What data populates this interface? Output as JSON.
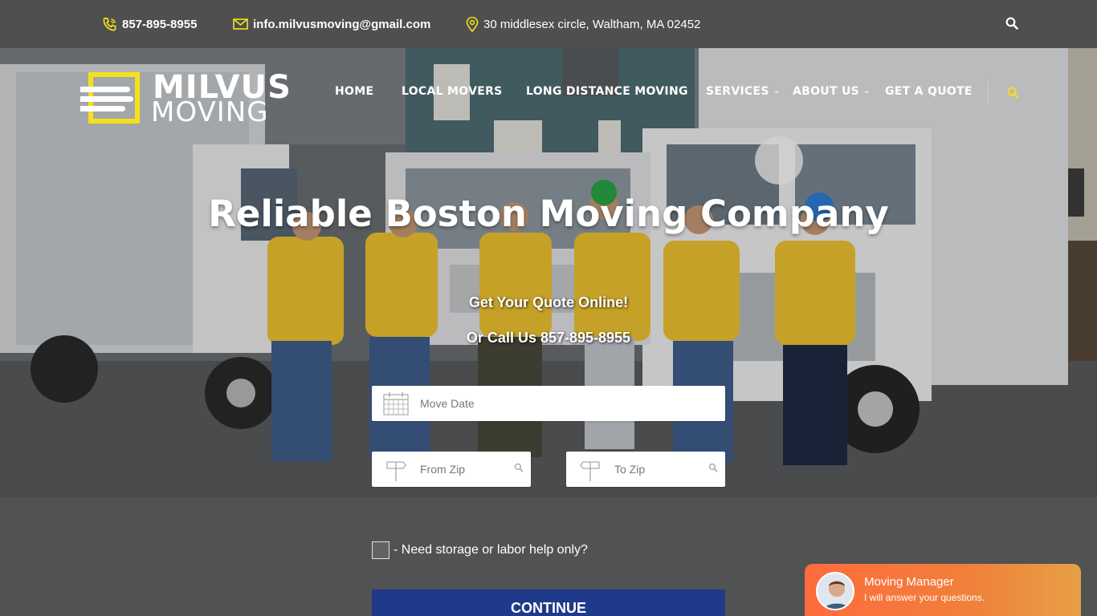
{
  "topbar": {
    "phone": "857-895-8955",
    "email": "info.milvusmoving@gmail.com",
    "address": "30 middlesex circle, Waltham, MA 02452",
    "icons": [
      "phone-icon",
      "mail-icon",
      "map-pin-icon",
      "search-icon"
    ]
  },
  "logo": {
    "line1": "MILVUS",
    "line2": "MOVING"
  },
  "nav": {
    "items": [
      {
        "label": "HOME"
      },
      {
        "label": "LOCAL MOVERS"
      },
      {
        "label": "LONG DISTANCE MOVING"
      },
      {
        "label": "SERVICES"
      },
      {
        "label": "ABOUT US"
      },
      {
        "label": "GET A QUOTE"
      }
    ]
  },
  "hero": {
    "title": "Reliable Boston Moving Company",
    "subtitle1": "Get Your Quote Online!",
    "subtitle2": "Or Call Us 857-895-8955"
  },
  "form": {
    "move_date_placeholder": "Move Date",
    "from_zip_placeholder": "From Zip",
    "to_zip_placeholder": "To Zip",
    "storage_label": "- Need storage or labor help only?",
    "continue_label": "CONTINUE"
  },
  "chat": {
    "title": "Moving Manager",
    "subtitle": "I will answer your questions."
  },
  "colors": {
    "accent_yellow": "#f5e11a",
    "button_blue": "#1f3a8a",
    "chat_orange": "#ff6b3d",
    "topbar_bg": "#4f4f4f"
  }
}
